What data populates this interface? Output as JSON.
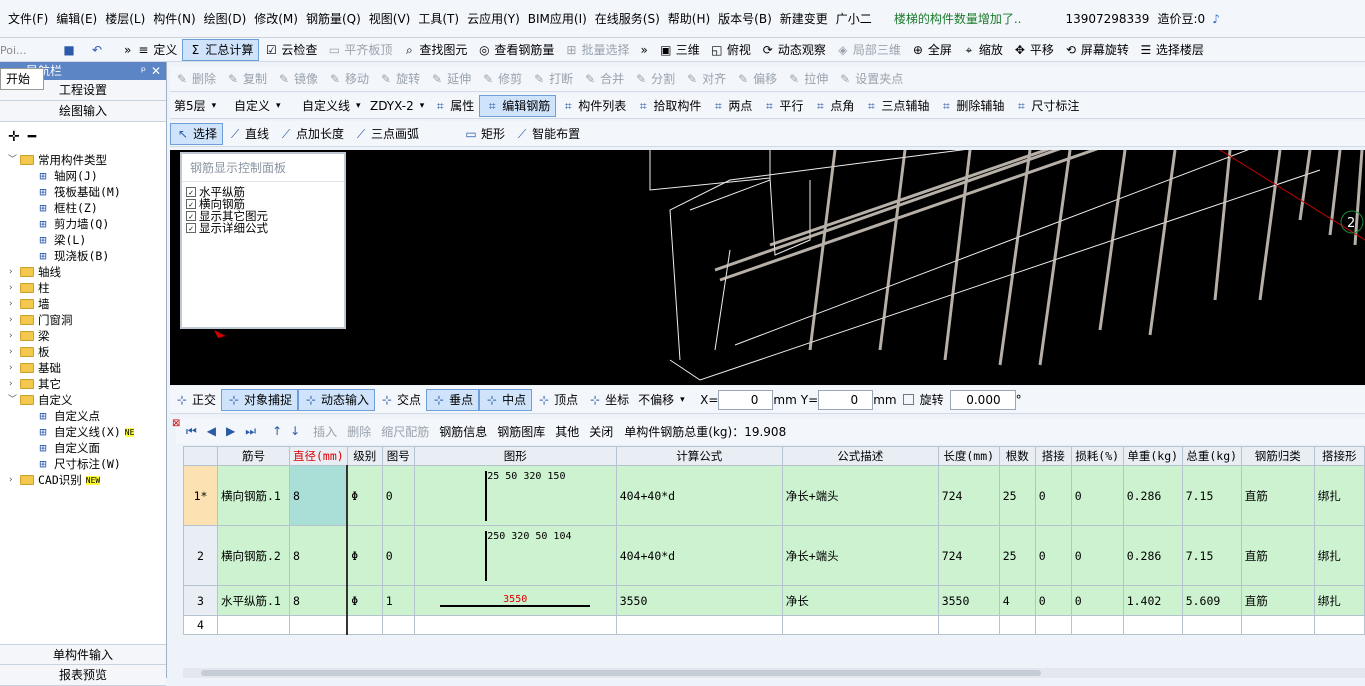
{
  "menu": [
    "文件(F)",
    "编辑(E)",
    "楼层(L)",
    "构件(N)",
    "绘图(D)",
    "修改(M)",
    "钢筋量(Q)",
    "视图(V)",
    "工具(T)",
    "云应用(Y)",
    "BIM应用(I)",
    "在线服务(S)",
    "帮助(H)",
    "版本号(B)",
    "新建变更",
    "广小二"
  ],
  "notice": "楼梯的构件数量增加了..",
  "user": "13907298339",
  "beans": "造价豆:0",
  "row2": [
    "定义",
    "汇总计算",
    "云检查",
    "平齐板顶",
    "查找图元",
    "查看钢筋量",
    "批量选择",
    "三维",
    "俯视",
    "动态观察",
    "局部三维",
    "全屏",
    "缩放",
    "平移",
    "屏幕旋转",
    "选择楼层"
  ],
  "toolbar_edit": [
    "删除",
    "复制",
    "镜像",
    "移动",
    "旋转",
    "延伸",
    "修剪",
    "打断",
    "合并",
    "分割",
    "对齐",
    "偏移",
    "拉伸",
    "设置夹点"
  ],
  "toolbar_props": {
    "floor": "第5层",
    "type": "自定义",
    "line": "自定义线",
    "code": "ZDYX-2",
    "items": [
      "属性",
      "编辑钢筋",
      "构件列表",
      "拾取构件",
      "两点",
      "平行",
      "点角",
      "三点辅轴",
      "删除辅轴",
      "尺寸标注"
    ]
  },
  "toolbar_draw": [
    "选择",
    "直线",
    "点加长度",
    "三点画弧",
    "矩形",
    "智能布置"
  ],
  "sidebar": {
    "title": "导航栏",
    "start_popup": "开始",
    "search_hint": "Poi...",
    "btn_project": "工程设置",
    "btn_draw": "绘图输入",
    "tree": [
      {
        "label": "常用构件类型",
        "level": 0,
        "open": true
      },
      {
        "label": "轴网(J)",
        "level": 1
      },
      {
        "label": "筏板基础(M)",
        "level": 1
      },
      {
        "label": "框柱(Z)",
        "level": 1
      },
      {
        "label": "剪力墙(Q)",
        "level": 1
      },
      {
        "label": "梁(L)",
        "level": 1
      },
      {
        "label": "现浇板(B)",
        "level": 1
      },
      {
        "label": "轴线",
        "level": 0
      },
      {
        "label": "柱",
        "level": 0
      },
      {
        "label": "墙",
        "level": 0
      },
      {
        "label": "门窗洞",
        "level": 0
      },
      {
        "label": "梁",
        "level": 0
      },
      {
        "label": "板",
        "level": 0
      },
      {
        "label": "基础",
        "level": 0
      },
      {
        "label": "其它",
        "level": 0
      },
      {
        "label": "自定义",
        "level": 0,
        "open": true
      },
      {
        "label": "自定义点",
        "level": 1
      },
      {
        "label": "自定义线(X)",
        "level": 1,
        "badge": "NE"
      },
      {
        "label": "自定义面",
        "level": 1
      },
      {
        "label": "尺寸标注(W)",
        "level": 1
      },
      {
        "label": "CAD识别",
        "level": 0,
        "badge": "NEW"
      }
    ],
    "btn_single": "单构件输入",
    "btn_report": "报表预览"
  },
  "panel": {
    "title": "钢筋显示控制面板",
    "items": [
      "水平纵筋",
      "横向钢筋",
      "显示其它图元",
      "显示详细公式"
    ]
  },
  "snap": {
    "items": [
      "正交",
      "对象捕捉",
      "动态输入",
      "交点",
      "垂点",
      "中点",
      "顶点",
      "坐标"
    ],
    "offset": "不偏移",
    "x_label": "X=",
    "x": "0",
    "y_label": "Y=",
    "y": "0",
    "unit": "mm",
    "rotate": "旋转",
    "angle": "0.000",
    "deg": "°"
  },
  "grid_tb": {
    "items": [
      "插入",
      "删除",
      "缩尺配筋",
      "钢筋信息",
      "钢筋图库",
      "其他",
      "关闭"
    ],
    "total": "单构件钢筋总重(kg)：19.908"
  },
  "canvas_label": "2",
  "table": {
    "headers": [
      "",
      "筋号",
      "直径(mm)",
      "级别",
      "图号",
      "图形",
      "计算公式",
      "公式描述",
      "长度(mm)",
      "根数",
      "搭接",
      "损耗(%)",
      "单重(kg)",
      "总重(kg)",
      "钢筋归类",
      "搭接形"
    ],
    "rows": [
      {
        "n": "1*",
        "name": "横向钢筋.1",
        "d": "8",
        "grade": "Φ",
        "fig": "0",
        "shape": "25 50 320 150",
        "formula": "404+40*d",
        "desc": "净长+端头",
        "len": "724",
        "count": "25",
        "lap": "0",
        "loss": "0",
        "unit": "0.286",
        "total": "7.15",
        "cat": "直筋",
        "laptype": "绑扎"
      },
      {
        "n": "2",
        "name": "横向钢筋.2",
        "d": "8",
        "grade": "Φ",
        "fig": "0",
        "shape": "250 320 50 104",
        "formula": "404+40*d",
        "desc": "净长+端头",
        "len": "724",
        "count": "25",
        "lap": "0",
        "loss": "0",
        "unit": "0.286",
        "total": "7.15",
        "cat": "直筋",
        "laptype": "绑扎"
      },
      {
        "n": "3",
        "name": "水平纵筋.1",
        "d": "8",
        "grade": "Φ",
        "fig": "1",
        "shape": "3550",
        "formula": "3550",
        "desc": "净长",
        "len": "3550",
        "count": "4",
        "lap": "0",
        "loss": "0",
        "unit": "1.402",
        "total": "5.609",
        "cat": "直筋",
        "laptype": "绑扎"
      },
      {
        "n": "4"
      }
    ]
  },
  "colors": {
    "accent": "#5b85c4",
    "green_row": "#ccf2cf",
    "selected": "#cfe3fb"
  }
}
